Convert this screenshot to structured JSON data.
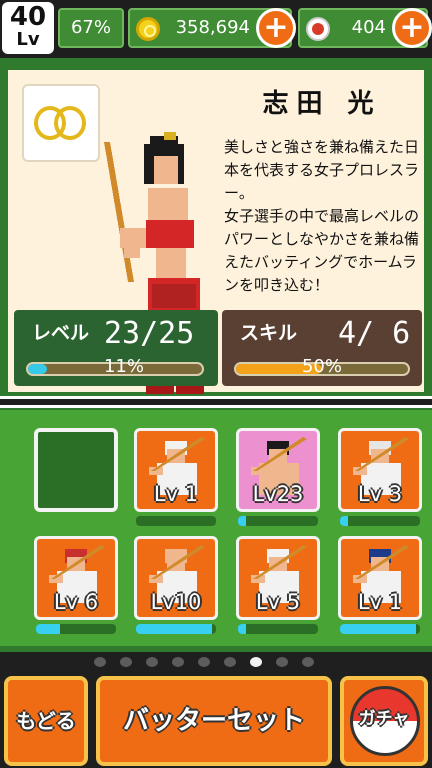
{
  "header": {
    "level_number": "40",
    "level_label": "Lv",
    "exp_percent": "67%",
    "coins": "358,694",
    "balls": "404",
    "plus_symbol": "+"
  },
  "player": {
    "name": "志田 光",
    "description": "美しさと強さを兼ね備えた日本を代表する女子プロレスラー。\n女子選手の中で最高レベルのパワーとしなやかさを兼ね備えたバッティングでホームランを叩き込む！",
    "level_label": "レベル",
    "level_value": "23/25",
    "level_percent": "11%",
    "level_progress": 0.11,
    "skill_label": "スキル",
    "skill_value": "4/ 6",
    "skill_percent": "50%",
    "skill_progress": 0.5
  },
  "cards": [
    {
      "lv": "",
      "empty": true,
      "progress": 0
    },
    {
      "lv": "Lv 1",
      "empty": false,
      "progress": 0
    },
    {
      "lv": "Lv23",
      "empty": false,
      "progress": 0.1
    },
    {
      "lv": "Lv 3",
      "empty": false,
      "progress": 0.1
    },
    {
      "lv": "Lv 6",
      "empty": false,
      "progress": 0.3
    },
    {
      "lv": "Lv10",
      "empty": false,
      "progress": 0.95
    },
    {
      "lv": "Lv 5",
      "empty": false,
      "progress": 0.1
    },
    {
      "lv": "Lv 1",
      "empty": false,
      "progress": 0.95
    }
  ],
  "pager": {
    "count": 9,
    "active_index": 6
  },
  "buttons": {
    "back": "もどる",
    "batter_set": "バッターセット",
    "gacha": "ガチャ"
  },
  "colors": {
    "accent": "#ef6b14",
    "field": "#48a535",
    "progress_blue": "#37c9e8",
    "progress_orange": "#f4a21a"
  }
}
